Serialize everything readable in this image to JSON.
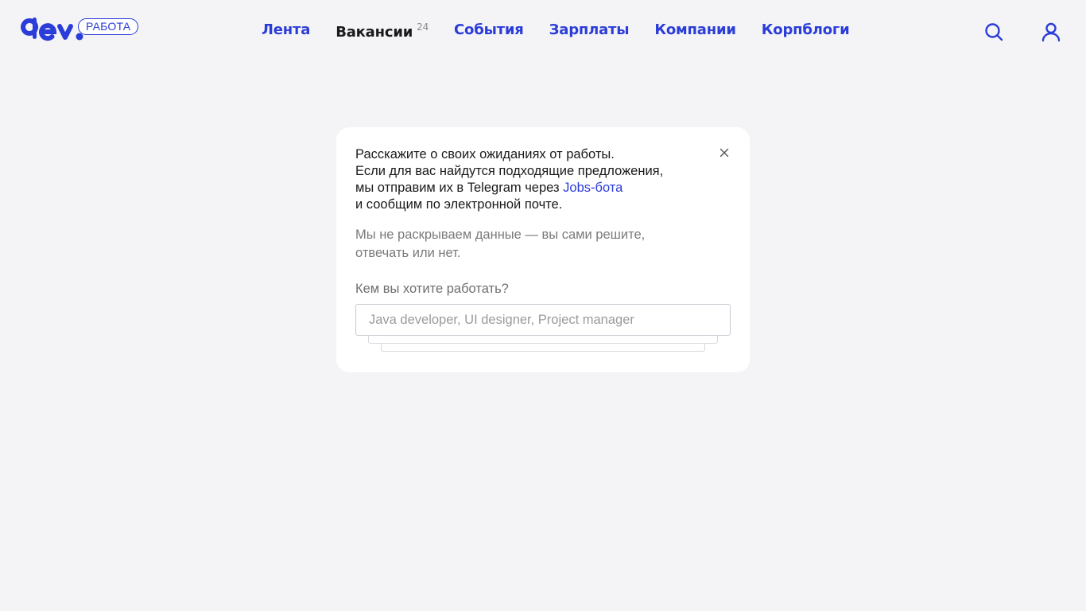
{
  "header": {
    "logo_alt": "dev.",
    "logo_badge": "РАБОТА",
    "nav": [
      {
        "label": "Лента",
        "active": false
      },
      {
        "label": "Вакансии",
        "active": true,
        "count": "24"
      },
      {
        "label": "События",
        "active": false
      },
      {
        "label": "Зарплаты",
        "active": false
      },
      {
        "label": "Компании",
        "active": false
      },
      {
        "label": "Корпблоги",
        "active": false
      }
    ],
    "icons": {
      "search": "search-icon",
      "profile": "user-icon"
    }
  },
  "card": {
    "intro_lines": [
      "Расскажите о своих ожиданиях от работы.",
      "Если для вас найдутся подходящие предложения,",
      "мы отправим их в Telegram через",
      "и сообщим по электронной почте."
    ],
    "bot_link": "Jobs-бота",
    "privacy_text": "Мы не раскрываем данные — вы сами решите, отвечать или нет.",
    "question": "Кем вы хотите работать?",
    "input_value": "",
    "input_placeholder": "Java developer, UI designer, Project manager",
    "close_icon": "close-icon"
  },
  "colors": {
    "accent": "#2b3dd8",
    "background": "#f4f4f7",
    "card": "#ffffff",
    "muted_text": "#7a7a7a"
  }
}
